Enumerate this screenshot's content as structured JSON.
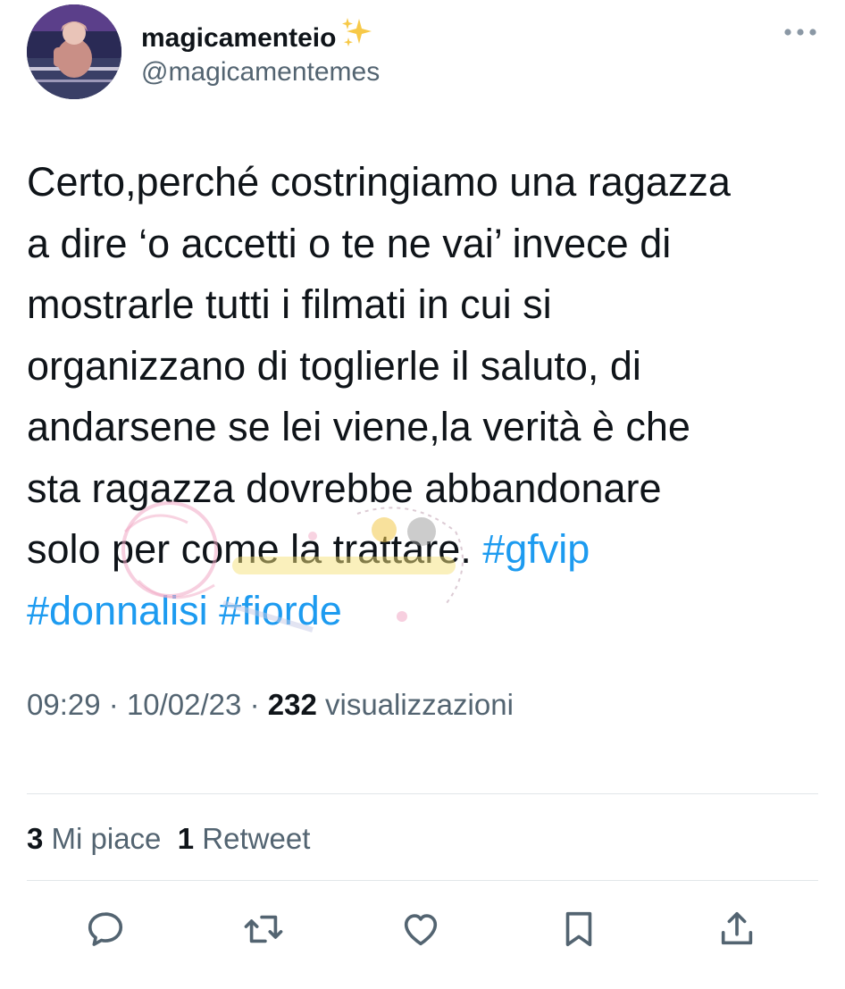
{
  "author": {
    "display_name": "magicamenteio",
    "handle": "@magicamentemes"
  },
  "tweet": {
    "lines": [
      {
        "text": "Certo,perché costringiamo una ragazza"
      },
      {
        "text": "a dire ‘o accetti o te ne vai’ invece di"
      },
      {
        "text": "mostrarle tutti i filmati in cui si"
      },
      {
        "text": "organizzano di toglierle il saluto, di"
      },
      {
        "text": "andarsene se lei viene,la verità è che"
      },
      {
        "text": "sta ragazza dovrebbe abbandonare"
      },
      {
        "text": "solo per come la trattare. ",
        "hashtag": "#gfvip"
      },
      {
        "hashtag1": "#donnalisi",
        "hashtag2": "#fiorde"
      }
    ]
  },
  "meta": {
    "time": "09:29",
    "separator": "·",
    "date": "10/02/23",
    "views_count": "232",
    "views_label": "visualizzazioni"
  },
  "stats": {
    "likes_count": "3",
    "likes_label": "Mi piace",
    "retweets_count": "1",
    "retweets_label": "Retweet"
  },
  "icons": {
    "sparkle": "sparkles-emoji-icon",
    "more": "more-options-icon",
    "reply": "reply-icon",
    "retweet": "retweet-icon",
    "like": "like-icon",
    "bookmark": "bookmark-icon",
    "share": "share-icon"
  },
  "colors": {
    "hashtag": "#1d9bf0",
    "secondary_text": "#536471",
    "primary_text": "#0f1419",
    "divider": "#e2e6e9"
  }
}
